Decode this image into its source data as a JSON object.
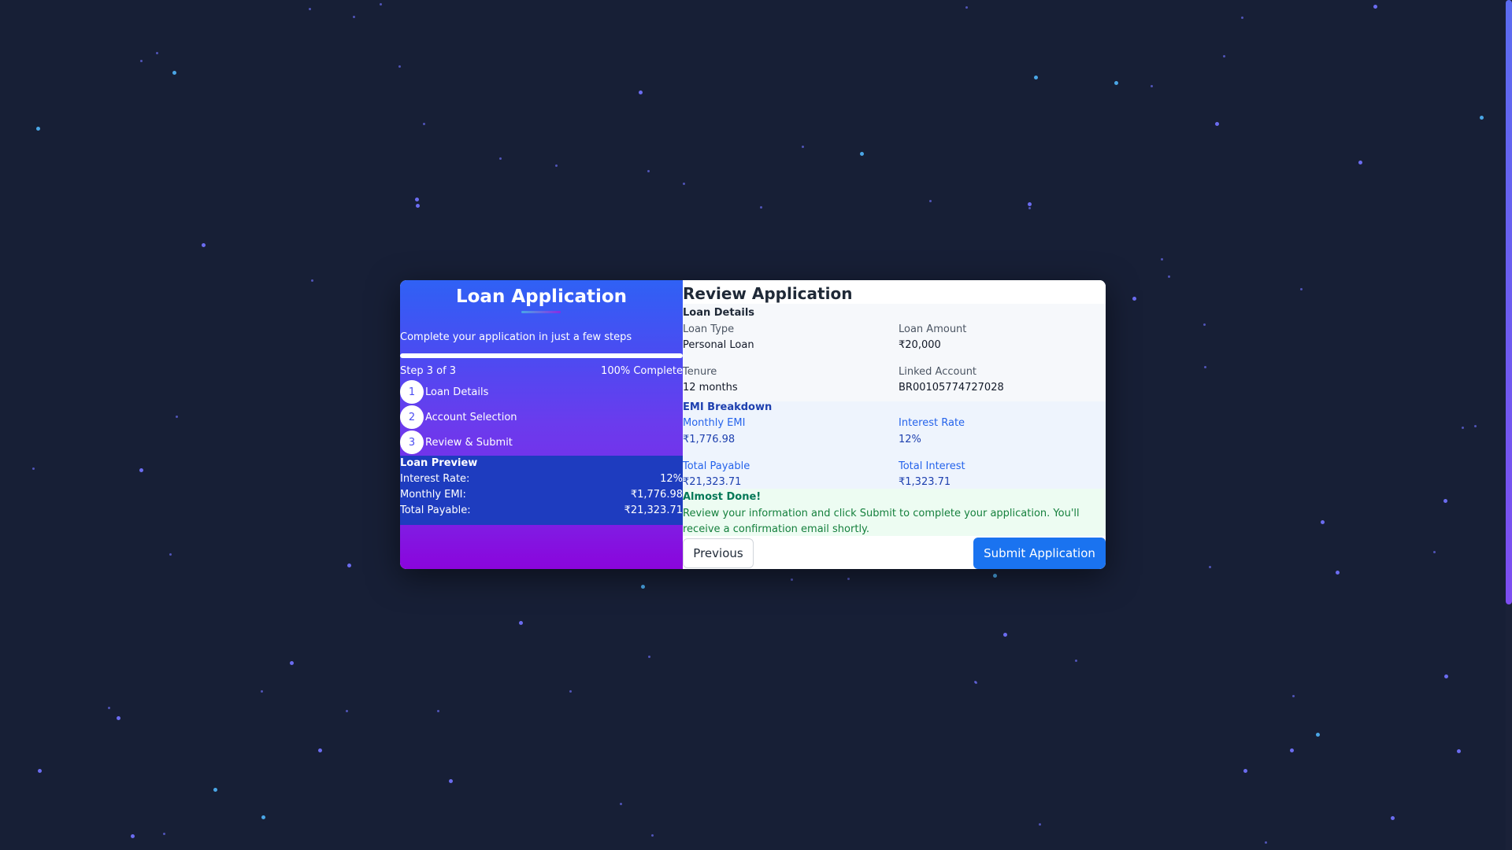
{
  "sidebar": {
    "title": "Loan Application",
    "subtitle": "Complete your application in just a few steps",
    "progress_percent": 100,
    "step_text": "Step 3 of 3",
    "progress_text": "100% Complete",
    "steps": [
      {
        "number": "1",
        "label": "Loan Details"
      },
      {
        "number": "2",
        "label": "Account Selection"
      },
      {
        "number": "3",
        "label": "Review & Submit"
      }
    ],
    "preview": {
      "title": "Loan Preview",
      "rows": [
        {
          "label": "Interest Rate:",
          "value": "12%"
        },
        {
          "label": "Monthly EMI:",
          "value": "₹1,776.98"
        },
        {
          "label": "Total Payable:",
          "value": "₹21,323.71"
        }
      ]
    }
  },
  "review": {
    "title": "Review Application",
    "loan_details": {
      "heading": "Loan Details",
      "fields": [
        {
          "label": "Loan Type",
          "value": "Personal Loan"
        },
        {
          "label": "Loan Amount",
          "value": "₹20,000"
        },
        {
          "label": "Tenure",
          "value": "12 months"
        },
        {
          "label": "Linked Account",
          "value": "BR00105774727028"
        }
      ]
    },
    "emi": {
      "heading": "EMI Breakdown",
      "fields": [
        {
          "label": "Monthly EMI",
          "value": "₹1,776.98"
        },
        {
          "label": "Interest Rate",
          "value": "12%"
        },
        {
          "label": "Total Payable",
          "value": "₹21,323.71"
        },
        {
          "label": "Total Interest",
          "value": "₹1,323.71"
        }
      ]
    },
    "notice": {
      "heading": "Almost Done!",
      "text": "Review your information and click Submit to complete your application. You'll receive a confirmation email shortly."
    },
    "buttons": {
      "previous": "Previous",
      "submit": "Submit Application"
    }
  }
}
